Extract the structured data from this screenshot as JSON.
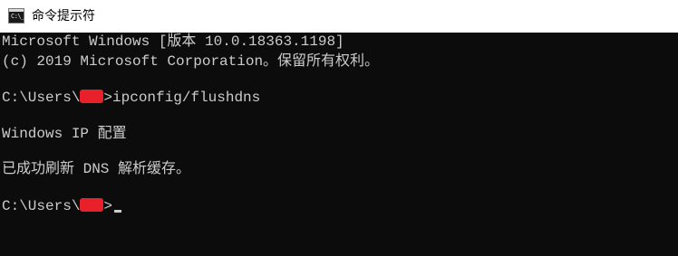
{
  "window": {
    "title": "命令提示符",
    "icon": "cmd-icon",
    "icon_glyph": "C:\\_"
  },
  "console": {
    "line1": "Microsoft Windows [版本 10.0.18363.1198]",
    "line2": "(c) 2019 Microsoft Corporation。保留所有权利。",
    "prompt1_prefix": "C:\\Users\\",
    "prompt1_suffix": ">ipconfig/flushdns",
    "line4": "Windows IP 配置",
    "line5": "已成功刷新 DNS 解析缓存。",
    "prompt2_prefix": "C:\\Users\\",
    "prompt2_suffix": ">"
  },
  "colors": {
    "console_bg": "#0c0c0c",
    "console_text": "#cccccc",
    "redaction": "#e8202a",
    "titlebar_bg": "#ffffff"
  }
}
